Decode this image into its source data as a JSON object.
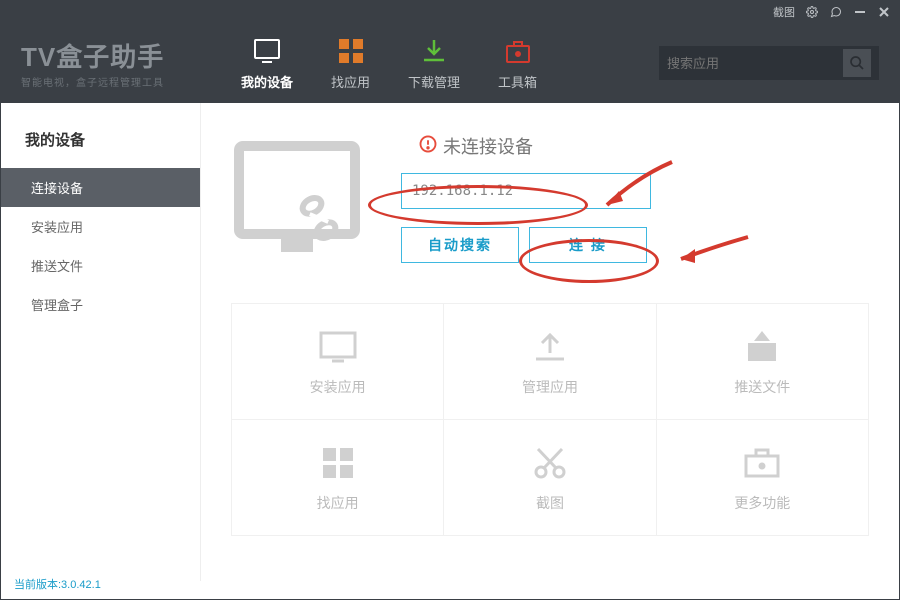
{
  "titlebar": {
    "screenshot_label": "截图"
  },
  "logo": {
    "title": "TV盒子助手",
    "subtitle": "智能电视，盒子远程管理工具"
  },
  "nav": {
    "items": [
      {
        "label": "我的设备",
        "active": true
      },
      {
        "label": "找应用",
        "active": false
      },
      {
        "label": "下载管理",
        "active": false
      },
      {
        "label": "工具箱",
        "active": false
      }
    ]
  },
  "search": {
    "placeholder": "搜索应用"
  },
  "sidebar": {
    "title": "我的设备",
    "items": [
      {
        "label": "连接设备",
        "active": true
      },
      {
        "label": "安装应用",
        "active": false
      },
      {
        "label": "推送文件",
        "active": false
      },
      {
        "label": "管理盒子",
        "active": false
      }
    ]
  },
  "connect": {
    "status_text": "未连接设备",
    "ip_value": "192.168.1.12",
    "auto_search_label": "自动搜索",
    "connect_label": "连  接"
  },
  "features": [
    {
      "label": "安装应用",
      "icon": "monitor"
    },
    {
      "label": "管理应用",
      "icon": "upload"
    },
    {
      "label": "推送文件",
      "icon": "upload-file"
    },
    {
      "label": "找应用",
      "icon": "grid"
    },
    {
      "label": "截图",
      "icon": "scissors"
    },
    {
      "label": "更多功能",
      "icon": "toolbox"
    }
  ],
  "footer": {
    "version_label": "当前版本:3.0.42.1"
  },
  "colors": {
    "accent": "#1a9cc9",
    "annot": "#d43a2e"
  }
}
